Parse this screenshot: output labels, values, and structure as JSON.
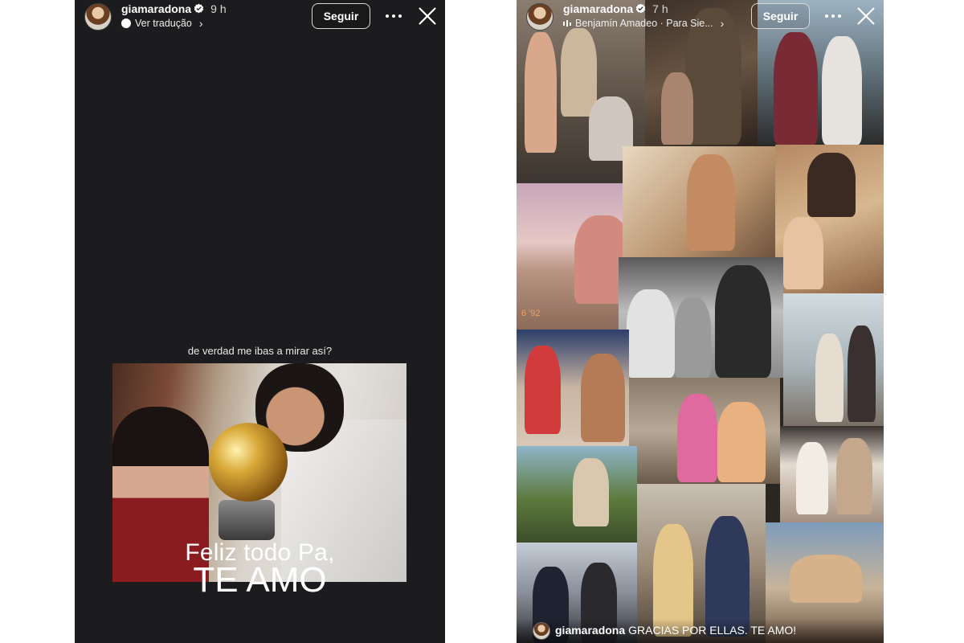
{
  "left_story": {
    "header": {
      "username": "giamaradona",
      "time": "9 h",
      "translation_label": "Ver tradução",
      "follow_label": "Seguir"
    },
    "caption_text": "de verdad me ibas a mirar así?",
    "overlay_line1": "Feliz todo Pa,",
    "overlay_line2": "TE AMO"
  },
  "right_story": {
    "header": {
      "username": "giamaradona",
      "time": "7 h",
      "music_label": "Benjamín Amadeo · Para Sie...",
      "follow_label": "Seguir"
    },
    "photo_date_stamp": "6 '92",
    "caption": {
      "username": "giamaradona",
      "text": "GRACIAS POR ELLAS. TE AMO!"
    }
  },
  "colors": {
    "left_background": "#1c1c1e",
    "text": "#ffffff",
    "verified_badge": "#ffffff"
  }
}
